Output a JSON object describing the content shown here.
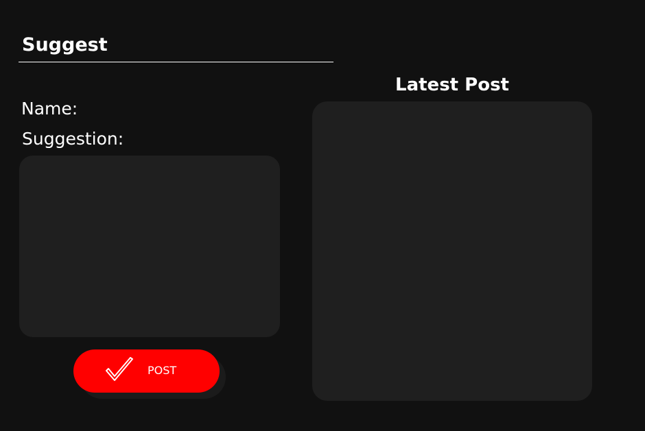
{
  "suggest": {
    "title": "Suggest",
    "name_label": "Name:",
    "suggestion_label": "Suggestion:",
    "suggestion_value": "",
    "post_button_label": "POST"
  },
  "latest": {
    "title": "Latest Post"
  },
  "colors": {
    "background": "#111111",
    "panel": "#1f1f1f",
    "accent": "#ff0000",
    "text": "#ffffff"
  },
  "icons": {
    "post_button_icon": "checkmark-icon"
  }
}
